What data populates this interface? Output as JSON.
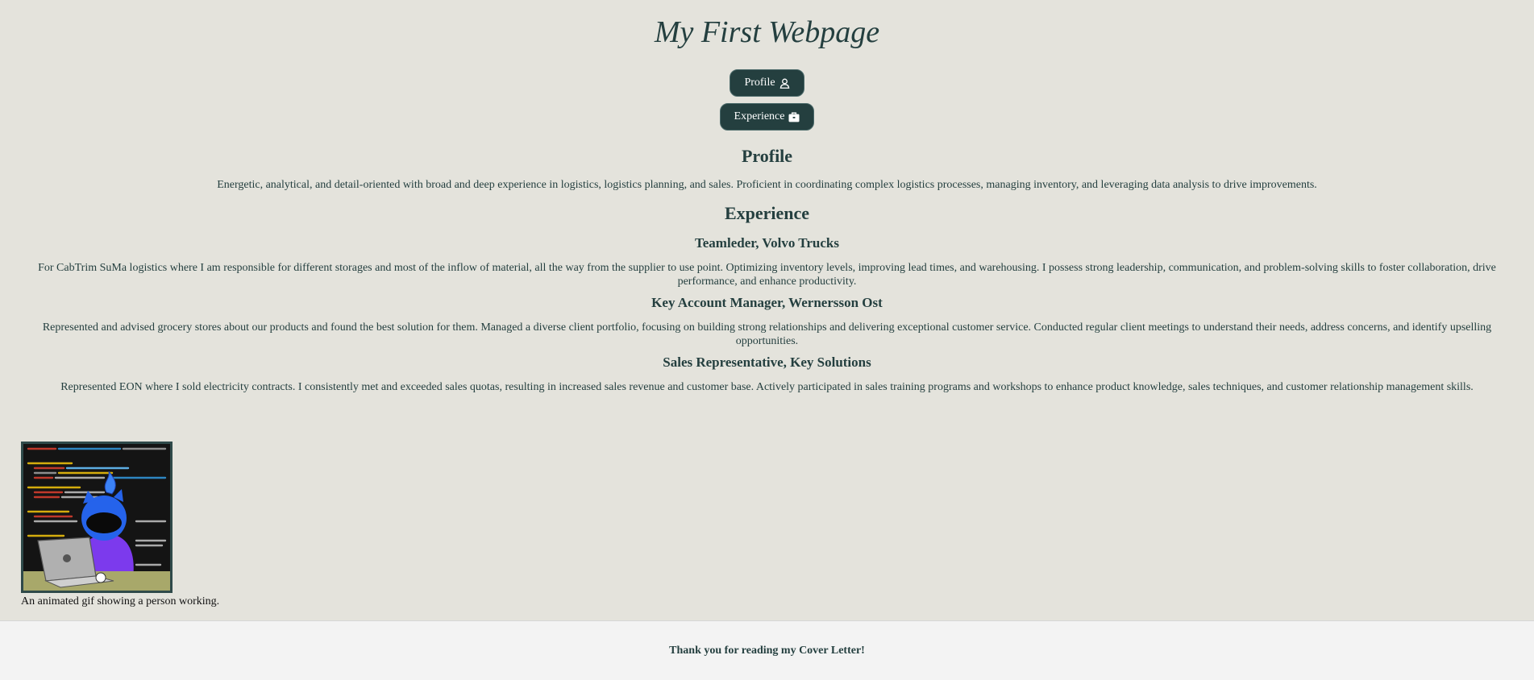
{
  "header": {
    "title": "My First Webpage"
  },
  "nav": {
    "profile_label": "Profile",
    "profile_icon": "user-icon",
    "experience_label": "Experience",
    "experience_icon": "briefcase-icon"
  },
  "profile": {
    "heading": "Profile",
    "text": "Energetic, analytical, and detail-oriented with broad and deep experience in logistics, logistics planning, and sales. Proficient in coordinating complex logistics processes, managing inventory, and leveraging data analysis to drive improvements."
  },
  "experience": {
    "heading": "Experience",
    "jobs": [
      {
        "title": "Teamleder, Volvo Trucks",
        "description": "For CabTrim SuMa logistics where I am responsible for different storages and most of the inflow of material, all the way from the supplier to use point. Optimizing inventory levels, improving lead times, and warehousing. I possess strong leadership, communication, and problem-solving skills to foster collaboration, drive performance, and enhance productivity."
      },
      {
        "title": "Key Account Manager, Wernersson Ost",
        "description": "Represented and advised grocery stores about our products and found the best solution for them. Managed a diverse client portfolio, focusing on building strong relationships and delivering exceptional customer service. Conducted regular client meetings to understand their needs, address concerns, and identify upselling opportunities."
      },
      {
        "title": "Sales Representative, Key Solutions",
        "description": "Represented EON where I sold electricity contracts. I consistently met and exceeded sales quotas, resulting in increased sales revenue and customer base. Actively participated in sales training programs and workshops to enhance product knowledge, sales techniques, and customer relationship management skills."
      }
    ]
  },
  "figure": {
    "caption": "An animated gif showing a person working."
  },
  "footer": {
    "text": "Thank you for reading my Cover Letter!"
  },
  "colors": {
    "background": "#e4e3dc",
    "accent": "#243f3f",
    "footer_background": "#f3f3f3"
  }
}
